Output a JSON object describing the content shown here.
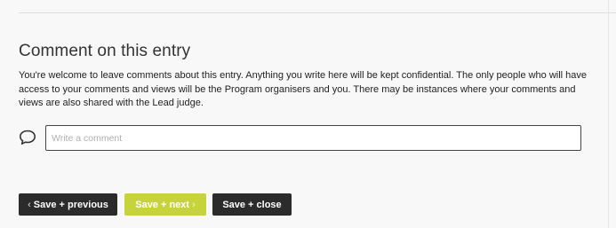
{
  "comment_section": {
    "title": "Comment on this entry",
    "description": "You're welcome to leave comments about this entry. Anything you write here will be kept confidential. The only people who will have access to your comments and views will be the Program organisers and you. There may be instances where your comments and views are also shared with the Lead judge.",
    "input": {
      "placeholder": "Write a comment",
      "value": ""
    },
    "icon": "speech-bubble-icon"
  },
  "actions": {
    "previous": {
      "label": "Save + previous",
      "icon": "chevron-left-icon",
      "color": "#2b2b2b"
    },
    "next": {
      "label": "Save + next",
      "icon": "chevron-right-icon",
      "color": "#c6d33b"
    },
    "close": {
      "label": "Save + close",
      "color": "#2b2b2b"
    }
  }
}
